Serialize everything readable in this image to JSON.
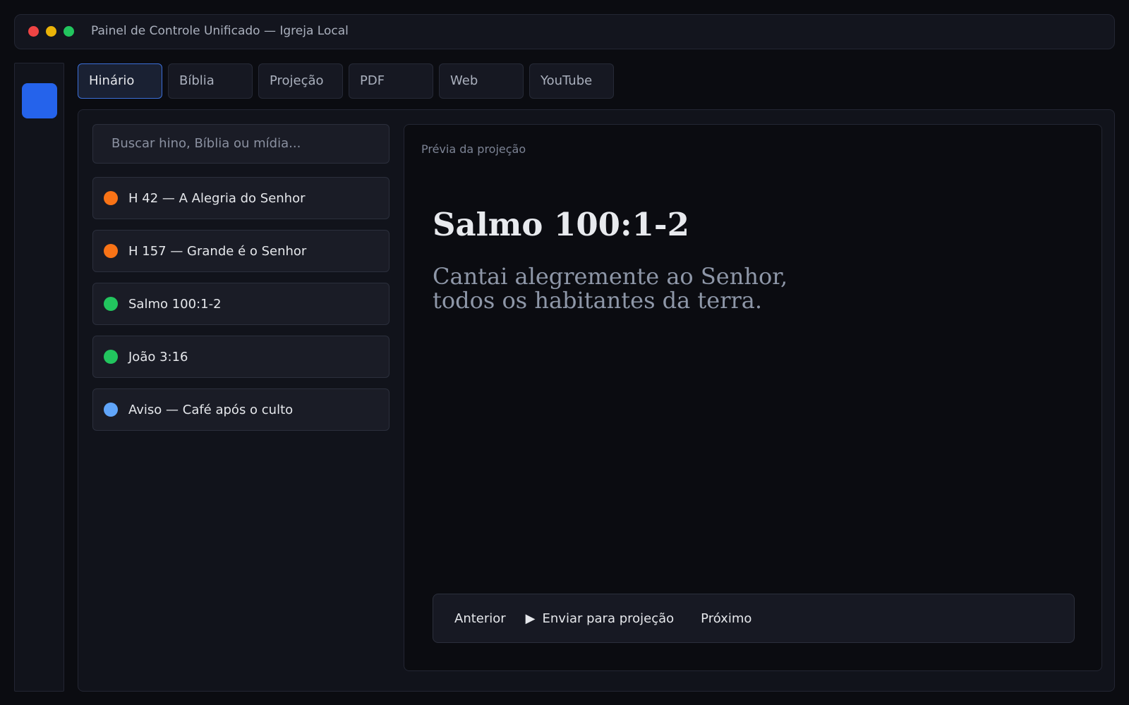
{
  "window": {
    "title": "Painel de Controle Unificado — Igreja Local",
    "controls": {
      "close_color": "#ef4444",
      "minimize_color": "#eab308",
      "maximize_color": "#22c55e"
    }
  },
  "sidebar": {
    "items": [
      {
        "icon": "",
        "name": "hymnal-icon",
        "active": true
      },
      {
        "icon": "",
        "name": "bible-icon",
        "active": false
      },
      {
        "icon": "",
        "name": "projection-icon",
        "active": false
      },
      {
        "icon": "",
        "name": "pdf-icon",
        "active": false
      },
      {
        "icon": "",
        "name": "web-icon",
        "active": false
      },
      {
        "icon": "",
        "name": "youtube-icon",
        "active": false
      }
    ],
    "active_color": "#2563eb"
  },
  "tabs": [
    {
      "label": "Hinário",
      "active": true
    },
    {
      "label": "Bíblia",
      "active": false
    },
    {
      "label": "Projeção",
      "active": false
    },
    {
      "label": "PDF",
      "active": false
    },
    {
      "label": "Web",
      "active": false
    },
    {
      "label": "YouTube",
      "active": false
    }
  ],
  "search": {
    "icon": "",
    "placeholder": "Buscar hino, Bíblia ou mídia..."
  },
  "playlist": [
    {
      "label": "H 42 — A Alegria do Senhor",
      "color": "#f97316"
    },
    {
      "label": "H 157 — Grande é o Senhor",
      "color": "#f97316"
    },
    {
      "label": "Salmo 100:1-2",
      "color": "#22c55e"
    },
    {
      "label": "João 3:16",
      "color": "#22c55e"
    },
    {
      "label": "Aviso — Café após o culto",
      "color": "#60a5fa"
    }
  ],
  "preview": {
    "label": "Prévia da projeção",
    "title": "Salmo 100:1-2",
    "line1": "Cantai alegremente ao Senhor,",
    "line2": "todos os habitantes da terra."
  },
  "controls": {
    "previous": {
      "icon": "",
      "label": "Anterior"
    },
    "send": {
      "icon": "▶",
      "label": "Enviar para projeção"
    },
    "next": {
      "icon": "",
      "label": "Próximo"
    }
  }
}
